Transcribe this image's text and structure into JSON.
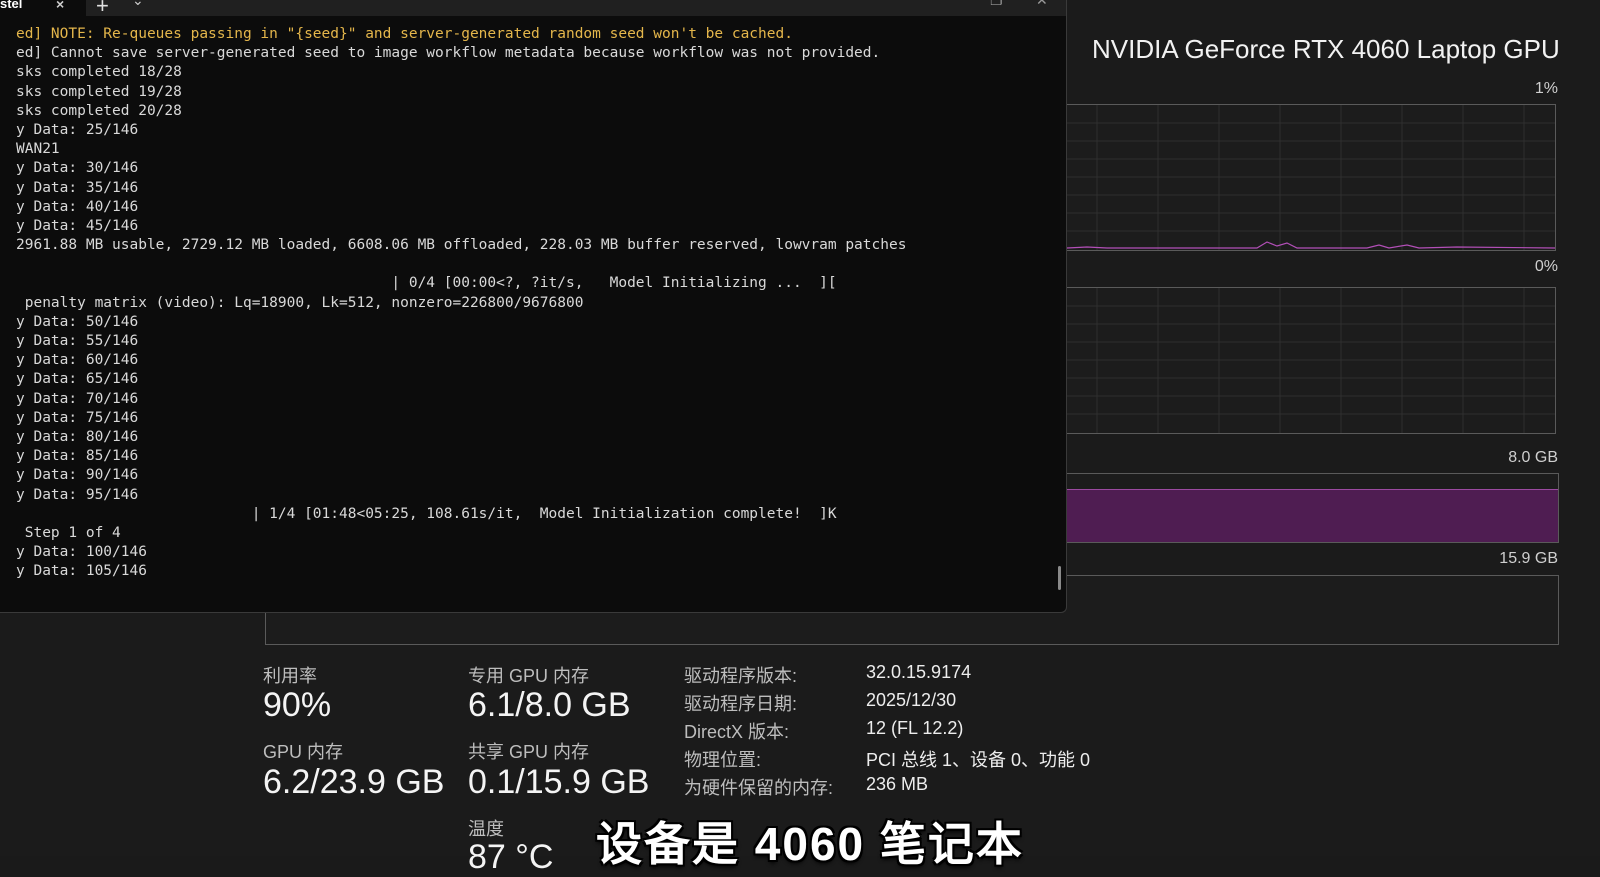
{
  "task_manager": {
    "gpu_name": "NVIDIA GeForce RTX 4060 Laptop GPU",
    "graphs": {
      "g1_label": "1%",
      "g2_label": "0%",
      "dedicated_mem_label": "8.0 GB",
      "shared_mem_label": "15.9 GB"
    },
    "dedicated_mem_fill_fraction": 0.76,
    "stats": {
      "utilization_label": "利用率",
      "utilization_value": "90%",
      "dedicated_mem_label": "专用 GPU 内存",
      "dedicated_mem_value": "6.1/8.0 GB",
      "gpu_mem_label": "GPU 内存",
      "gpu_mem_value": "6.2/23.9 GB",
      "shared_mem_label": "共享 GPU 内存",
      "shared_mem_value": "0.1/15.9 GB",
      "temp_label": "温度",
      "temp_value": "87 °C"
    },
    "info": [
      {
        "key": "驱动程序版本:",
        "value": "32.0.15.9174"
      },
      {
        "key": "驱动程序日期:",
        "value": "2025/12/30"
      },
      {
        "key": "DirectX 版本:",
        "value": "12 (FL 12.2)"
      },
      {
        "key": "物理位置:",
        "value": "PCI 总线 1、设备 0、功能 0"
      },
      {
        "key": "为硬件保留的内存:",
        "value": "236 MB"
      }
    ]
  },
  "terminal": {
    "tab_title": "stel",
    "tab_close": "×",
    "new_tab": "+",
    "tab_menu": "⌄",
    "lines": [
      {
        "text": "ed] NOTE: Re-queues passing in \"{seed}\" and server-generated random seed won't be cached.",
        "style": "warn"
      },
      {
        "text": "ed] Cannot save server-generated seed to image workflow metadata because workflow was not provided.",
        "style": "normal"
      },
      {
        "text": "sks completed 18/28",
        "style": "normal"
      },
      {
        "text": "sks completed 19/28",
        "style": "normal"
      },
      {
        "text": "sks completed 20/28",
        "style": "normal"
      },
      {
        "text": "y Data: 25/146",
        "style": "normal"
      },
      {
        "text": "WAN21",
        "style": "normal"
      },
      {
        "text": "y Data: 30/146",
        "style": "normal"
      },
      {
        "text": "y Data: 35/146",
        "style": "normal"
      },
      {
        "text": "y Data: 40/146",
        "style": "normal"
      },
      {
        "text": "y Data: 45/146",
        "style": "normal"
      },
      {
        "text": "2961.88 MB usable, 2729.12 MB loaded, 6608.06 MB offloaded, 228.03 MB buffer reserved, lowvram patches",
        "style": "normal"
      },
      {
        "text": "",
        "style": "normal"
      },
      {
        "text": "                                           | 0/4 [00:00<?, ?it/s,   Model Initializing ...  ][",
        "style": "normal"
      },
      {
        "text": " penalty matrix (video): Lq=18900, Lk=512, nonzero=226800/9676800",
        "style": "normal"
      },
      {
        "text": "y Data: 50/146",
        "style": "normal"
      },
      {
        "text": "y Data: 55/146",
        "style": "normal"
      },
      {
        "text": "y Data: 60/146",
        "style": "normal"
      },
      {
        "text": "y Data: 65/146",
        "style": "normal"
      },
      {
        "text": "y Data: 70/146",
        "style": "normal"
      },
      {
        "text": "y Data: 75/146",
        "style": "normal"
      },
      {
        "text": "y Data: 80/146",
        "style": "normal"
      },
      {
        "text": "y Data: 85/146",
        "style": "normal"
      },
      {
        "text": "y Data: 90/146",
        "style": "normal"
      },
      {
        "text": "y Data: 95/146",
        "style": "normal"
      },
      {
        "text": "                           | 1/4 [01:48<05:25, 108.61s/it,  Model Initialization complete!  ]K",
        "style": "normal"
      },
      {
        "text": " Step 1 of 4",
        "style": "normal"
      },
      {
        "text": "y Data: 100/146",
        "style": "normal"
      },
      {
        "text": "y Data: 105/146",
        "style": "normal"
      }
    ]
  },
  "subtitle": "设备是 4060 笔记本"
}
